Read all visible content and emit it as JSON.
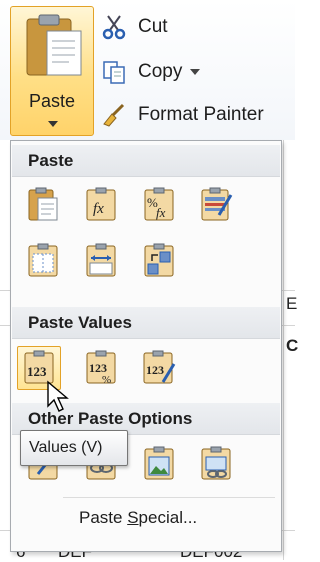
{
  "ribbon": {
    "paste_label": "Paste",
    "cut_label": "Cut",
    "copy_label": "Copy",
    "format_painter_label": "Format Painter"
  },
  "menu": {
    "paste_header": "Paste",
    "paste_values_header": "Paste Values",
    "other_options_header": "Other Paste Options",
    "paste_special_prefix": "Paste ",
    "paste_special_underlined": "S",
    "paste_special_suffix": "pecial...",
    "value_glyph": "123",
    "formula_glyph": "fx",
    "percent_glyph": "%"
  },
  "tooltip": {
    "text": "Values (V)"
  },
  "background": {
    "cell_e": "E",
    "cell_c": "C",
    "row_6": "6",
    "cell_def": "DEF",
    "cell_def002": "DEF002"
  },
  "colors": {
    "accent_border": "#e3a227",
    "accent_fill": "#ffdf86"
  }
}
